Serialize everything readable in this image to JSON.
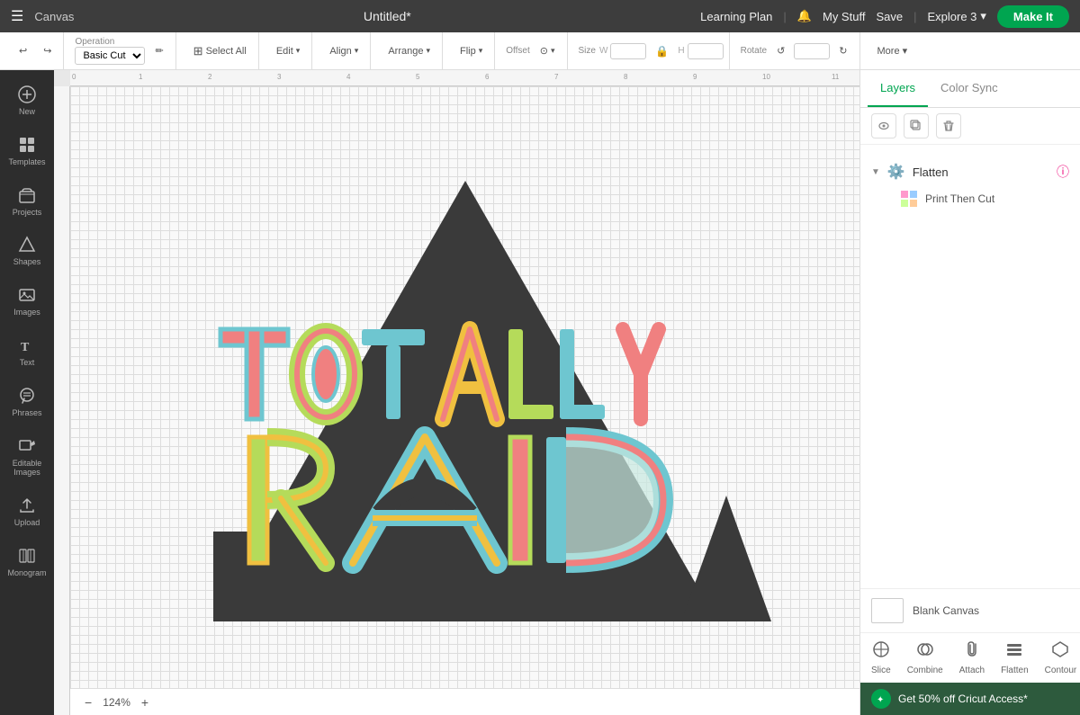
{
  "topnav": {
    "hamburger": "☰",
    "canvas_label": "Canvas",
    "title": "Untitled*",
    "learning_plan": "Learning Plan",
    "my_stuff": "My Stuff",
    "save": "Save",
    "machine": "Explore 3",
    "make_it": "Make It"
  },
  "toolbar": {
    "undo_icon": "↩",
    "redo_icon": "↪",
    "operation_label": "Operation",
    "operation_value": "Basic Cut",
    "select_all": "Select All",
    "edit": "Edit",
    "align": "Align",
    "arrange": "Arrange",
    "flip": "Flip",
    "offset": "Offset",
    "size": "Size",
    "rotate": "Rotate",
    "more": "More ▾"
  },
  "sidebar": {
    "items": [
      {
        "id": "new",
        "label": "New",
        "icon": "+"
      },
      {
        "id": "templates",
        "label": "Templates",
        "icon": "⊞"
      },
      {
        "id": "projects",
        "label": "Projects",
        "icon": "📁"
      },
      {
        "id": "shapes",
        "label": "Shapes",
        "icon": "◇"
      },
      {
        "id": "images",
        "label": "Images",
        "icon": "🖼"
      },
      {
        "id": "text",
        "label": "Text",
        "icon": "T"
      },
      {
        "id": "phrases",
        "label": "Phrases",
        "icon": "💬"
      },
      {
        "id": "editable-images",
        "label": "Editable Images",
        "icon": "✏"
      },
      {
        "id": "upload",
        "label": "Upload",
        "icon": "⬆"
      },
      {
        "id": "monogram",
        "label": "Monogram",
        "icon": "M"
      }
    ]
  },
  "right_panel": {
    "tabs": [
      {
        "id": "layers",
        "label": "Layers",
        "active": true
      },
      {
        "id": "color-sync",
        "label": "Color Sync",
        "active": false
      }
    ],
    "icons": [
      "eye",
      "duplicate",
      "trash"
    ],
    "layers": {
      "group_label": "Flatten",
      "group_icon": "⚙",
      "items": [
        {
          "label": "Print Then Cut"
        }
      ]
    },
    "blank_canvas_label": "Blank Canvas"
  },
  "bottom_toolbar": {
    "items": [
      {
        "id": "slice",
        "label": "Slice",
        "icon": "⊕"
      },
      {
        "id": "combine",
        "label": "Combine",
        "icon": "⊗"
      },
      {
        "id": "attach",
        "label": "Attach",
        "icon": "📎"
      },
      {
        "id": "flatten",
        "label": "Flatten",
        "icon": "▤"
      },
      {
        "id": "contour",
        "label": "Contour",
        "icon": "⬡"
      }
    ]
  },
  "zoom": {
    "level": "124%",
    "minus_icon": "−",
    "plus_icon": "+"
  },
  "promo": {
    "text": "Get 50% off Cricut Access*",
    "icon": "✦"
  },
  "ruler": {
    "ticks": [
      "0",
      "1",
      "2",
      "3",
      "4",
      "5",
      "6",
      "7",
      "8",
      "9",
      "10",
      "11"
    ]
  }
}
